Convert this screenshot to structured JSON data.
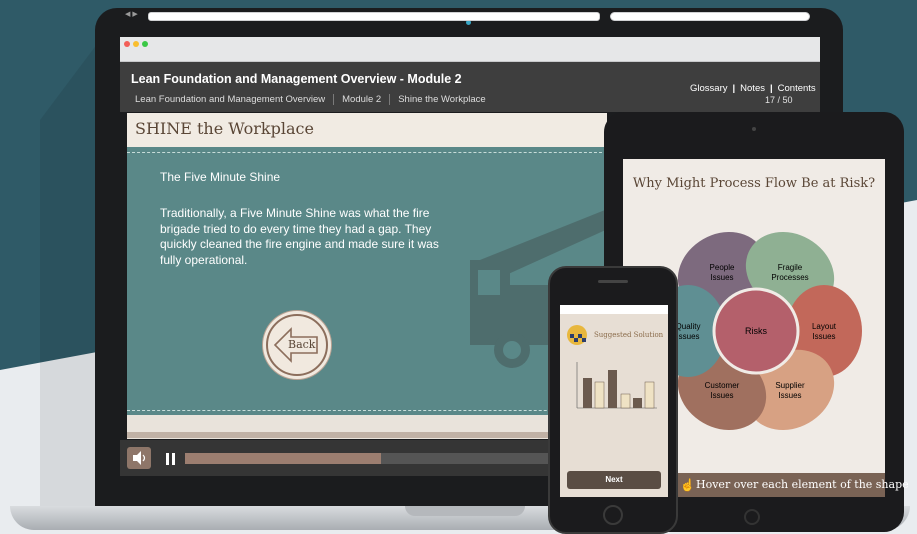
{
  "course": {
    "title": "Lean Foundation and Management Overview - Module 2",
    "breadcrumbs": [
      "Lean Foundation and Management Overview",
      "Module 2",
      "Shine the Workplace"
    ],
    "links": [
      "Glossary",
      "Notes",
      "Contents"
    ],
    "page_counter": "17 / 50"
  },
  "slide": {
    "title": "SHINE the Workplace",
    "subtitle": "The Five Minute Shine",
    "body": "Traditionally, a Five Minute Shine was what the fire brigade tried to do every time they had a gap. They quickly cleaned the fire engine and made sure it was fully operational.",
    "back_label": "Back"
  },
  "player": {
    "progress_fraction": 0.53
  },
  "tablet": {
    "title": "Why Might Process Flow Be at Risk?",
    "center_label": "Risks",
    "segments": [
      {
        "label": "People Issues",
        "color": "#7d6a7e"
      },
      {
        "label": "Fragile Processes",
        "color": "#8fb093"
      },
      {
        "label": "Layout Issues",
        "color": "#c2685a"
      },
      {
        "label": "Supplier Issues",
        "color": "#d7a183"
      },
      {
        "label": "Customer Issues",
        "color": "#a0705f"
      },
      {
        "label": "Quality Issues",
        "color": "#5f8f93"
      }
    ],
    "footer": "Hover over each element of the shape"
  },
  "phone": {
    "title": "Suggested Solution",
    "next_label": "Next"
  },
  "colors": {
    "slide_teal": "#5a8888",
    "header_dark": "#3e3e3e",
    "accent_brown": "#9c7e70"
  }
}
